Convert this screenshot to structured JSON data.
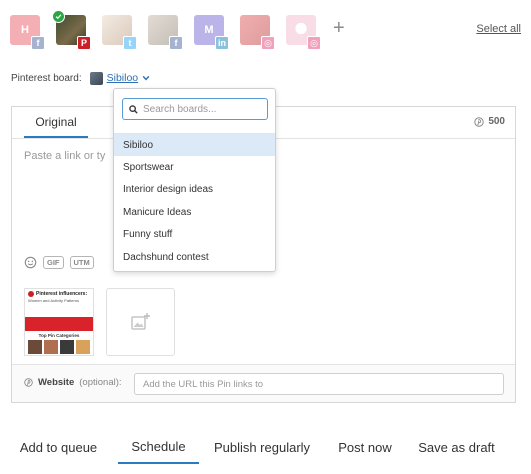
{
  "accounts": [
    {
      "initials": "H",
      "network": "facebook",
      "network_glyph": "f",
      "bg": "#e8505b",
      "net_color": "#3b5998",
      "selected": false
    },
    {
      "initials": "",
      "network": "pinterest",
      "network_glyph": "P",
      "bg": "#4a5a3c",
      "net_color": "#cb2027",
      "selected": true
    },
    {
      "initials": "",
      "network": "twitter",
      "network_glyph": "t",
      "bg": "#c9a98a",
      "net_color": "#1da1f2",
      "selected": false
    },
    {
      "initials": "",
      "network": "facebook",
      "network_glyph": "f",
      "bg": "#9c8f7a",
      "net_color": "#3b5998",
      "selected": false
    },
    {
      "initials": "M",
      "network": "linkedin",
      "network_glyph": "in",
      "bg": "#6a5acd",
      "net_color": "#0077b5",
      "selected": false
    },
    {
      "initials": "",
      "network": "instagram",
      "network_glyph": "◎",
      "bg": "#e04848",
      "net_color": "#e1306c",
      "selected": false
    },
    {
      "initials": "",
      "network": "instagram",
      "network_glyph": "◎",
      "bg": "#f3b6c8",
      "net_color": "#e1306c",
      "selected": false
    }
  ],
  "add_account_glyph": "+",
  "select_all_label": "Select all",
  "board": {
    "label": "Pinterest board:",
    "current": "Sibiloo"
  },
  "dropdown": {
    "search_placeholder": "Search boards...",
    "items": [
      "Sibiloo",
      "Sportswear",
      "Interior design ideas",
      "Manicure Ideas",
      "Funny stuff",
      "Dachshund contest"
    ],
    "selected_index": 0
  },
  "composer": {
    "tab_label": "Original",
    "char_count": "500",
    "placeholder": "Paste a link or ty",
    "tools": [
      "GIF",
      "UTM"
    ],
    "thumbnail": {
      "title": "Pinterest influencers:",
      "subtitle": "Women and Activity Patterns",
      "section": "Top Pin Categories"
    },
    "website": {
      "label": "Website",
      "optional": "(optional):",
      "placeholder": "Add the URL this Pin links to"
    }
  },
  "bottom_tabs": [
    {
      "label": "Add to queue",
      "active": false
    },
    {
      "label": "Schedule",
      "active": true
    },
    {
      "label": "Publish regularly",
      "active": false
    },
    {
      "label": "Post now",
      "active": false
    },
    {
      "label": "Save as draft",
      "active": false
    }
  ],
  "colors": {
    "accent": "#2a7bbf",
    "pinterest": "#cb2027",
    "check": "#2aa744"
  }
}
